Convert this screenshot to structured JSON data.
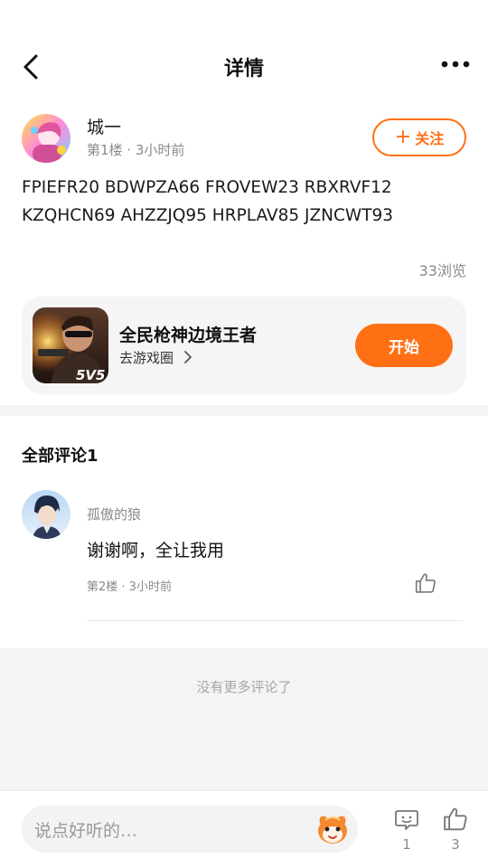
{
  "nav": {
    "title": "详情"
  },
  "post": {
    "author": "城一",
    "meta": "第1楼 · 3小时前",
    "follow_label": "关注",
    "body_line1": "FPIEFR20 BDWPZA66 FROVEW23 RBXRVF12",
    "body_line2": "KZQHCN69 AHZZJQ95 HRPLAV85 JZNCWT93",
    "views": "33浏览"
  },
  "game_card": {
    "name": "全民枪神边境王者",
    "link_label": "去游戏圈",
    "icon_badge": "5V5",
    "start_label": "开始"
  },
  "comments": {
    "title": "全部评论1",
    "items": [
      {
        "author": "孤傲的狼",
        "text": "谢谢啊，全让我用",
        "meta": "第2楼 · 3小时前"
      }
    ],
    "no_more": "没有更多评论了"
  },
  "bottom_bar": {
    "placeholder": "说点好听的…",
    "comment_count": "1",
    "like_count": "3"
  },
  "colors": {
    "accent": "#ff7014",
    "muted_text": "#8a8a8a",
    "gray_bg": "#f4f4f4"
  },
  "icons": [
    "back-arrow-icon",
    "more-icon",
    "plus-icon",
    "chevron-right-icon",
    "thumbs-up-icon",
    "comment-bubble-icon",
    "mascot-icon"
  ]
}
